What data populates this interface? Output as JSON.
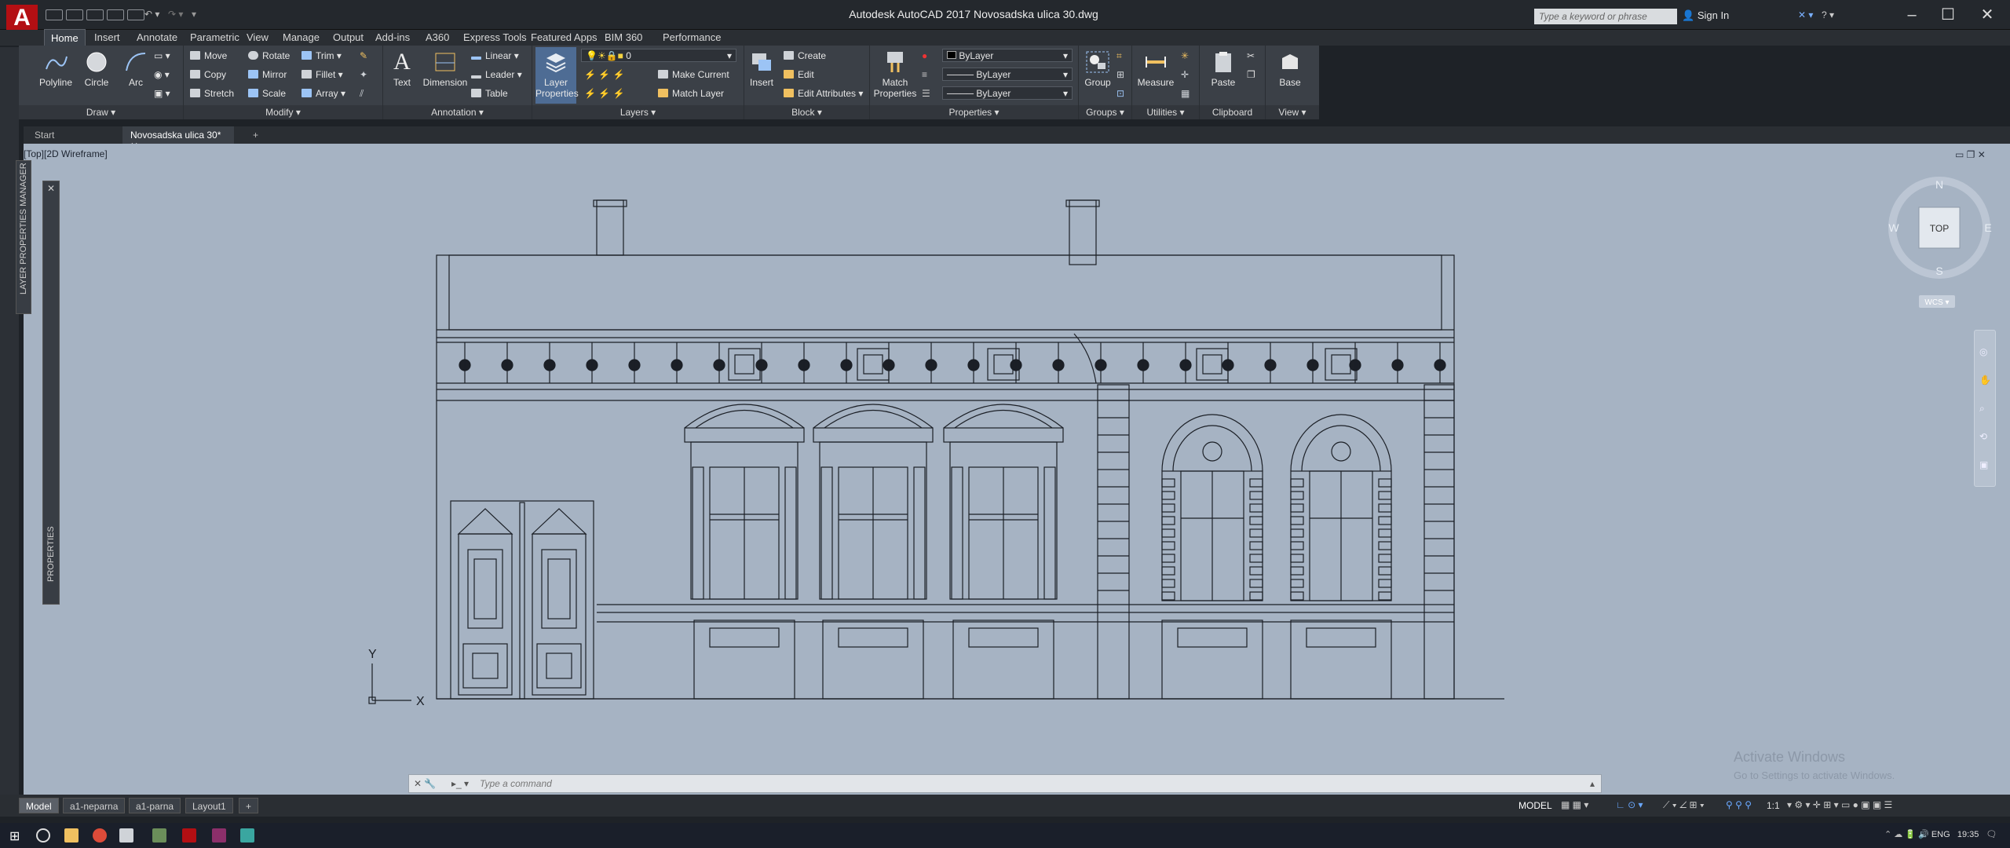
{
  "window": {
    "title": "Autodesk AutoCAD 2017    Novosadska ulica 30.dwg",
    "app_letter": "A"
  },
  "search": {
    "placeholder": "Type a keyword or phrase"
  },
  "account": {
    "signin": "Sign In"
  },
  "ribbon_tabs": [
    "Home",
    "Insert",
    "Annotate",
    "Parametric",
    "View",
    "Manage",
    "Output",
    "Add-ins",
    "A360",
    "Express Tools",
    "Featured Apps",
    "BIM 360",
    "Performance"
  ],
  "draw": {
    "polyline": "Polyline",
    "circle": "Circle",
    "arc": "Arc",
    "label": "Draw ▾"
  },
  "modify": {
    "move": "Move",
    "rotate": "Rotate",
    "trim": "Trim",
    "copy": "Copy",
    "mirror": "Mirror",
    "fillet": "Fillet",
    "stretch": "Stretch",
    "scale": "Scale",
    "array": "Array",
    "label": "Modify ▾"
  },
  "annotation": {
    "text": "Text",
    "dimension": "Dimension",
    "linear": "Linear",
    "leader": "Leader",
    "table": "Table",
    "label": "Annotation ▾"
  },
  "layers": {
    "layer_properties_1": "Layer",
    "layer_properties_2": "Properties",
    "current_layer": "0",
    "make_current": "Make Current",
    "match_layer": "Match Layer",
    "label": "Layers ▾"
  },
  "block": {
    "insert": "Insert",
    "create": "Create",
    "edit": "Edit",
    "edit_attributes": "Edit Attributes",
    "label": "Block ▾"
  },
  "properties": {
    "match_1": "Match",
    "match_2": "Properties",
    "color": "ByLayer",
    "linetype": "ByLayer",
    "lineweight": "ByLayer",
    "label": "Properties ▾"
  },
  "groups": {
    "group": "Group",
    "label": "Groups ▾"
  },
  "utilities": {
    "measure": "Measure",
    "label": "Utilities ▾"
  },
  "clipboard": {
    "paste": "Paste",
    "label": "Clipboard"
  },
  "view": {
    "base": "Base",
    "label": "View ▾"
  },
  "doc_tabs": {
    "start": "Start",
    "drawing": "Novosadska ulica 30*",
    "add": "+"
  },
  "viewport": {
    "label": "[Top][2D Wireframe]"
  },
  "palettes": {
    "layer_manager": "LAYER PROPERTIES MANAGER",
    "properties": "PROPERTIES"
  },
  "viewcube": {
    "top": "TOP",
    "n": "N",
    "s": "S",
    "e": "E",
    "w": "W",
    "wcs": "WCS ▾"
  },
  "ucs": {
    "x": "X",
    "y": "Y"
  },
  "command": {
    "placeholder": "Type  a  command"
  },
  "watermark": {
    "line1": "Activate Windows",
    "line2": "Go to Settings to activate Windows."
  },
  "layout_tabs": [
    "Model",
    "a1-neparna",
    "a1-parna",
    "Layout1"
  ],
  "status": {
    "model": "MODEL",
    "scale": "1:1"
  },
  "tray": {
    "lang": "ENG",
    "time": "19:35"
  },
  "colors": {
    "canvas": "#a6b3c3",
    "ribbon": "#3b4047",
    "accent": "#b30f13",
    "line": "#1b1f26"
  }
}
